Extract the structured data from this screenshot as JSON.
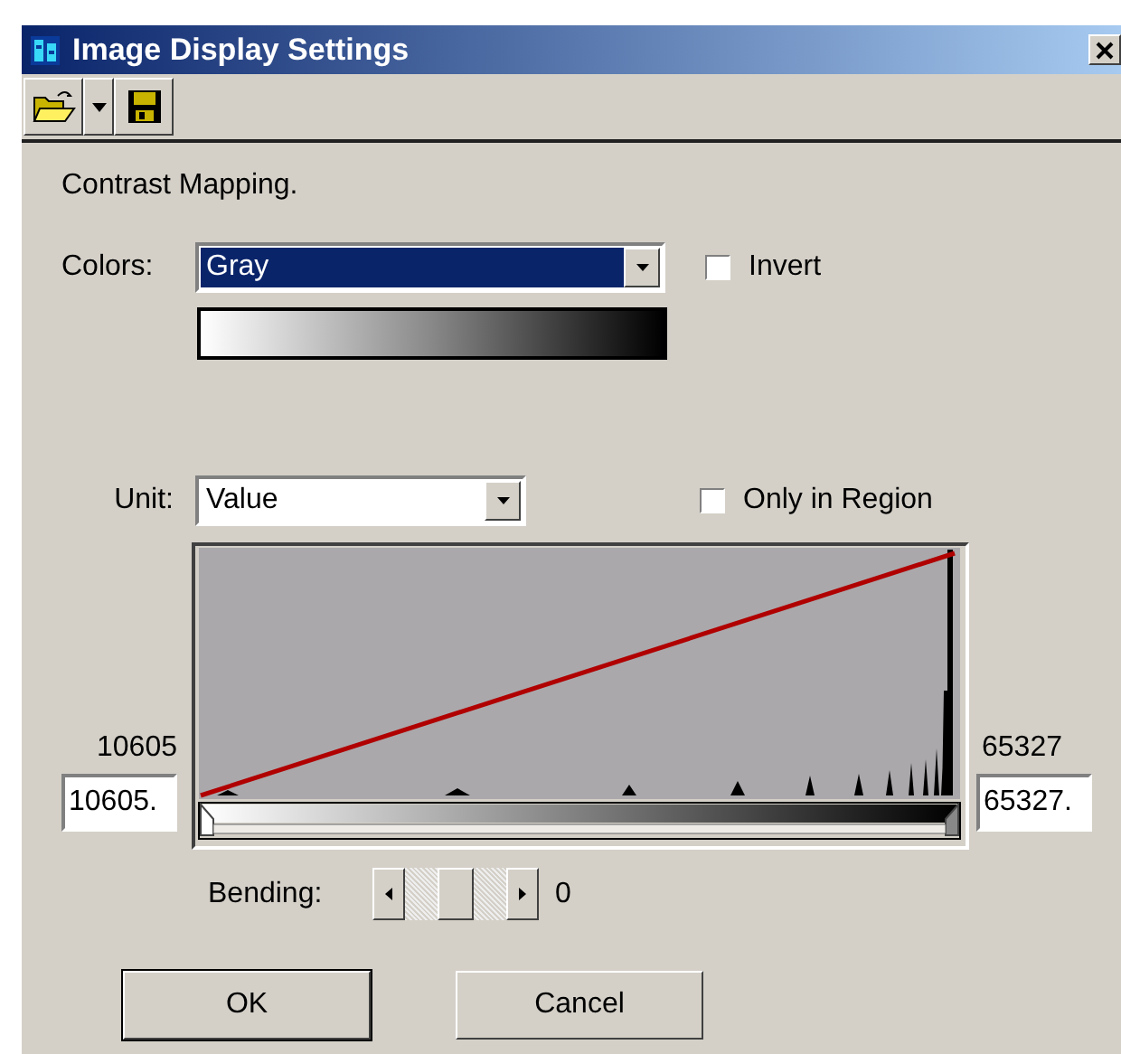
{
  "window": {
    "title": "Image Display Settings"
  },
  "toolbar": [
    {
      "kind": "open"
    },
    {
      "kind": "dropdown"
    },
    {
      "kind": "save"
    }
  ],
  "section_label": "Contrast Mapping.",
  "colors": {
    "label": "Colors:",
    "value": "Gray",
    "focused": true
  },
  "invert": {
    "label": "Invert",
    "checked": false
  },
  "unit": {
    "label": "Unit:",
    "value": "Value"
  },
  "only_in_region": {
    "label": "Only in Region",
    "checked": false
  },
  "range": {
    "min_label": "10605",
    "min_value": "10605.",
    "max_label": "65327",
    "max_value": "65327."
  },
  "bending": {
    "label": "Bending:",
    "reading": "0"
  },
  "buttons": [
    {
      "label": "OK",
      "default": true
    },
    {
      "label": "Cancel",
      "default": false
    }
  ]
}
